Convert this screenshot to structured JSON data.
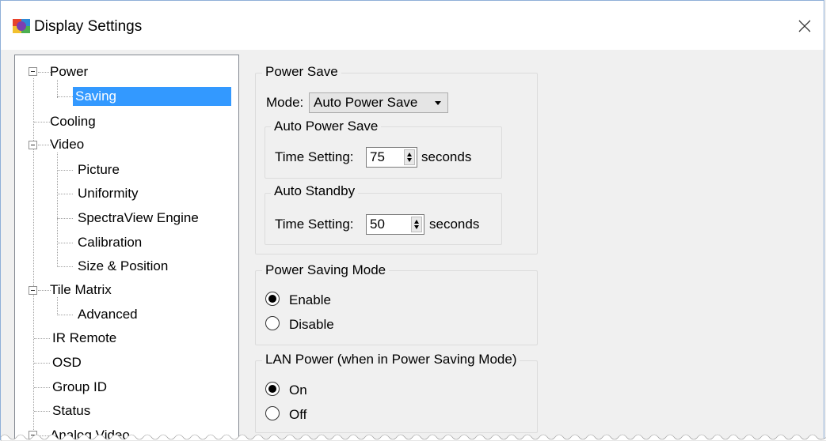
{
  "window": {
    "title": "Display Settings"
  },
  "icons": {
    "app": "display-settings-app-icon",
    "close": "close-icon",
    "expander": "tree-collapse-icon"
  },
  "colors": {
    "selection": "#3399ff",
    "window_bg": "#f0f0f0",
    "title_bg": "#ffffff"
  },
  "tree": {
    "items": [
      {
        "label": "Power"
      },
      {
        "label": "Saving"
      },
      {
        "label": "Cooling"
      },
      {
        "label": "Video"
      },
      {
        "label": "Picture"
      },
      {
        "label": "Uniformity"
      },
      {
        "label": "SpectraView Engine"
      },
      {
        "label": "Calibration"
      },
      {
        "label": "Size & Position"
      },
      {
        "label": "Tile Matrix"
      },
      {
        "label": "Advanced"
      },
      {
        "label": "IR Remote"
      },
      {
        "label": "OSD"
      },
      {
        "label": "Group ID"
      },
      {
        "label": "Status"
      },
      {
        "label": "Analog Video"
      }
    ],
    "selected": "Saving"
  },
  "power_save": {
    "title": "Power Save",
    "mode_label": "Mode:",
    "mode_value": "Auto Power Save",
    "auto_power_save": {
      "title": "Auto Power Save",
      "time_label": "Time Setting:",
      "value": "75",
      "unit": "seconds"
    },
    "auto_standby": {
      "title": "Auto Standby",
      "time_label": "Time Setting:",
      "value": "50",
      "unit": "seconds"
    }
  },
  "power_saving_mode": {
    "title": "Power Saving Mode",
    "options": [
      "Enable",
      "Disable"
    ],
    "selected": "Enable"
  },
  "lan_power": {
    "title": "LAN Power (when in Power Saving Mode)",
    "options": [
      "On",
      "Off"
    ],
    "selected": "On"
  }
}
